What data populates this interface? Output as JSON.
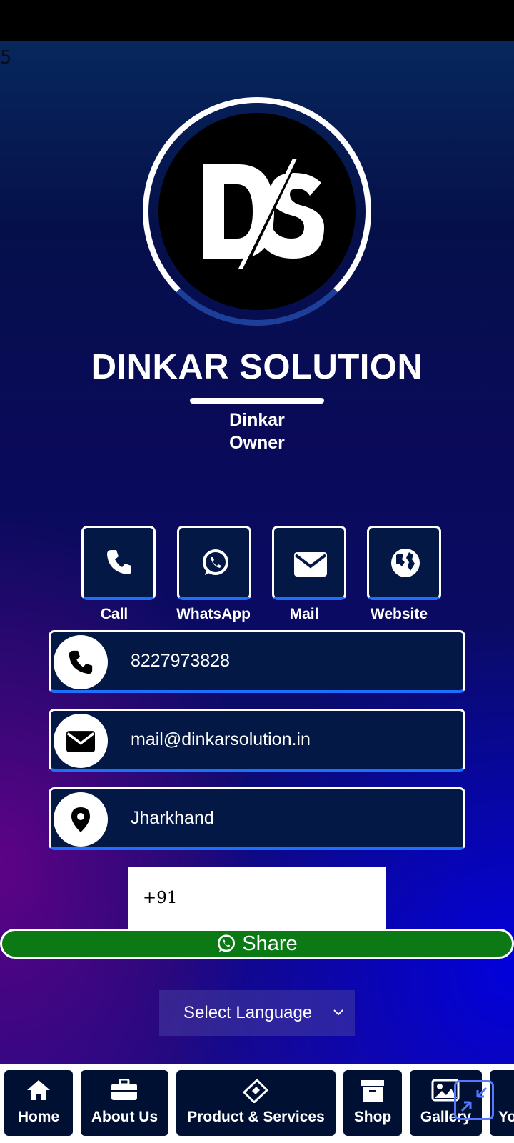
{
  "corner_number": "5",
  "company_name": "DINKAR SOLUTION",
  "logo_text": "DS",
  "person": {
    "name": "Dinkar",
    "role": "Owner"
  },
  "quick_actions": [
    {
      "label": "Call",
      "icon": "phone-icon"
    },
    {
      "label": "WhatsApp",
      "icon": "whatsapp-icon"
    },
    {
      "label": "Mail",
      "icon": "mail-icon"
    },
    {
      "label": "Website",
      "icon": "globe-icon"
    }
  ],
  "contact": {
    "phone": "8227973828",
    "email": "mail@dinkarsolution.in",
    "location": "Jharkhand"
  },
  "share_form": {
    "phone_prefix": "+91",
    "share_label": "Share"
  },
  "language_select": {
    "selected": "Select Language"
  },
  "bottom_nav": [
    {
      "label": "Home",
      "icon": "home-icon"
    },
    {
      "label": "About Us",
      "icon": "briefcase-icon"
    },
    {
      "label": "Product & Services",
      "icon": "tag-icon"
    },
    {
      "label": "Shop",
      "icon": "box-icon"
    },
    {
      "label": "Gallery",
      "icon": "image-icon"
    },
    {
      "label": "Yo",
      "icon": "video-icon"
    }
  ],
  "colors": {
    "card_bg": "#041846",
    "accent": "#1e6fff",
    "share_green": "#0b7a14"
  }
}
